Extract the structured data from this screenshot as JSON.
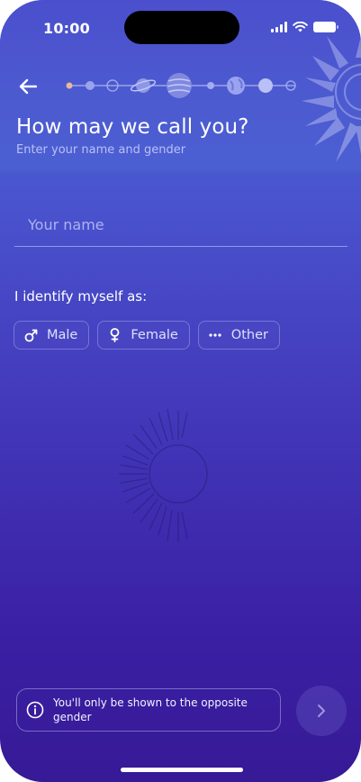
{
  "status_bar": {
    "time": "10:00"
  },
  "screen": {
    "title": "How may we call you?",
    "subtitle": "Enter your name and gender"
  },
  "name_field": {
    "placeholder": "Your name",
    "value": ""
  },
  "gender": {
    "label": "I identify myself as:",
    "options": [
      {
        "label": "Male",
        "icon": "male-icon"
      },
      {
        "label": "Female",
        "icon": "female-icon"
      },
      {
        "label": "Other",
        "icon": "more-dots-icon"
      }
    ]
  },
  "footer": {
    "info_text": "You'll only be shown to the opposite gender",
    "info_icon": "info-icon",
    "next_icon": "chevron-right-icon"
  },
  "progress": {
    "steps": 9,
    "current_step": 1
  },
  "colors": {
    "background_top": "#4f63d6",
    "background_bottom": "#361a96",
    "accent": "#ffffff"
  }
}
